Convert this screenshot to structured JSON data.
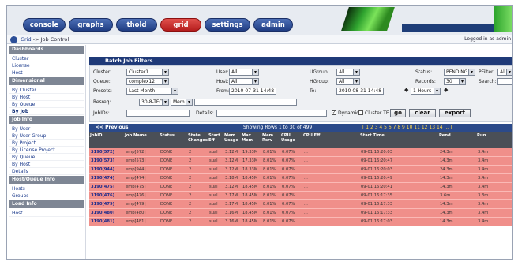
{
  "top_tabs": [
    {
      "label": "console",
      "active": false
    },
    {
      "label": "graphs",
      "active": false
    },
    {
      "label": "thold",
      "active": false
    },
    {
      "label": "grid",
      "active": true
    },
    {
      "label": "settings",
      "active": false
    },
    {
      "label": "admin",
      "active": false
    }
  ],
  "breadcrumb": {
    "home": "Grid",
    "separator": "->",
    "current": "Job Control"
  },
  "logged_in": "Logged in as admin",
  "sidebar": {
    "sections": [
      {
        "header": "Dashboards",
        "items": [
          "Cluster",
          "License",
          "Host"
        ]
      },
      {
        "header": "Dimensional",
        "items": [
          "By Cluster",
          "By Host",
          "By Queue",
          "By Job"
        ]
      },
      {
        "header": "Job Info",
        "items": [
          "By User",
          "By User Group",
          "By Project",
          "By License Project",
          "By Queue",
          "By Host",
          "Details"
        ]
      },
      {
        "header": "Host/Queue Info",
        "items": [
          "Hosts",
          "Groups"
        ]
      },
      {
        "header": "Load Info",
        "items": [
          "Host"
        ]
      }
    ]
  },
  "filters": {
    "title": "Batch Job Filters",
    "cluster_label": "Cluster:",
    "cluster_value": "Cluster1",
    "user_label": "User:",
    "user_value": "All",
    "ugroup_label": "UGroup:",
    "ugroup_value": "All",
    "status_label": "Status:",
    "status_value": "PENDING",
    "pfilter_label": "PFilter:",
    "pfilter_value": "All",
    "queue_label": "Queue:",
    "queue_value": "complex12",
    "host_label": "Host:",
    "host_value": "All",
    "hgroup_label": "HGroup:",
    "hgroup_value": "All",
    "records_label": "Records:",
    "records_value": "30",
    "search_label": "Search:",
    "search_value": "",
    "presets_label": "Presets:",
    "presets_value": "Last Month",
    "from_label": "From:",
    "from_value": "2010-07-31 14:48",
    "to_label": "To:",
    "to_value": "2010-08-31 14:48",
    "interval_value": "1 Hours",
    "resreq_label": "Resreq:",
    "resreq_value": "30-8-TFC",
    "resreq_op": "Mem",
    "jobids_label": "JobIDs:",
    "jobids_value": "",
    "details_label": "Details:",
    "details_value": "",
    "dynamic_label": "Dynamic",
    "cluster_te_label": "Cluster TE",
    "go_label": "go",
    "clear_label": "clear",
    "export_label": "export"
  },
  "nav": {
    "previous": "<< Previous",
    "showing": "Showing Rows 1 to 30 of 499",
    "pages": "[ 1  2  3  4  5  6  7  8  9  10  11  12  13  14 ... ]"
  },
  "columns": [
    "JobID",
    "Job Name",
    "Status",
    "State Changes",
    "Start Eff",
    "Mem Usage",
    "Max Mem",
    "Mem Rsrv",
    "CPU Usage",
    "CPU Eff",
    "Start Time",
    "Pend",
    "Run"
  ],
  "rows": [
    [
      "3190[572]",
      "emp[572]",
      "DONE",
      "2",
      "sual",
      "3.12M",
      "19.33M",
      "8.01%",
      "0.07%",
      "...",
      "09-01 16:20:03",
      "24.3m",
      "3.4m"
    ],
    [
      "3190[573]",
      "emp[573]",
      "DONE",
      "2",
      "sual",
      "3.12M",
      "17.33M",
      "8.01%",
      "0.07%",
      "...",
      "09-01 16:20:47",
      "14.3m",
      "3.4m"
    ],
    [
      "3190[944]",
      "emp[944]",
      "DONE",
      "2",
      "sual",
      "3.12M",
      "18.33M",
      "8.01%",
      "0.07%",
      "...",
      "09-01 16:20:03",
      "24.3m",
      "3.4m"
    ],
    [
      "3190[474]",
      "emp[474]",
      "DONE",
      "2",
      "sual",
      "3.18M",
      "18.45M",
      "8.01%",
      "0.07%",
      "...",
      "09-01 16:20:49",
      "14.3m",
      "3.4m"
    ],
    [
      "3190[475]",
      "emp[475]",
      "DONE",
      "2",
      "sual",
      "3.12M",
      "18.45M",
      "8.01%",
      "0.07%",
      "...",
      "09-01 16:20:41",
      "14.3m",
      "3.4m"
    ],
    [
      "3190[476]",
      "emp[476]",
      "DONE",
      "2",
      "sual",
      "3.17M",
      "18.45M",
      "8.01%",
      "0.07%",
      "...",
      "09-01 16:17:35",
      "3.6m",
      "3.3m"
    ],
    [
      "3190[479]",
      "emp[479]",
      "DONE",
      "2",
      "sual",
      "3.17M",
      "18.45M",
      "8.01%",
      "0.07%",
      "...",
      "09-01 16:17:33",
      "14.3m",
      "3.4m"
    ],
    [
      "3190[480]",
      "emp[480]",
      "DONE",
      "2",
      "sual",
      "3.16M",
      "18.45M",
      "8.01%",
      "0.07%",
      "...",
      "09-01 16:17:33",
      "14.3m",
      "3.4m"
    ],
    [
      "3190[481]",
      "emp[481]",
      "DONE",
      "2",
      "sual",
      "3.16M",
      "18.45M",
      "8.01%",
      "0.07%",
      "...",
      "09-01 16:17:03",
      "14.3m",
      "3.4m"
    ]
  ]
}
